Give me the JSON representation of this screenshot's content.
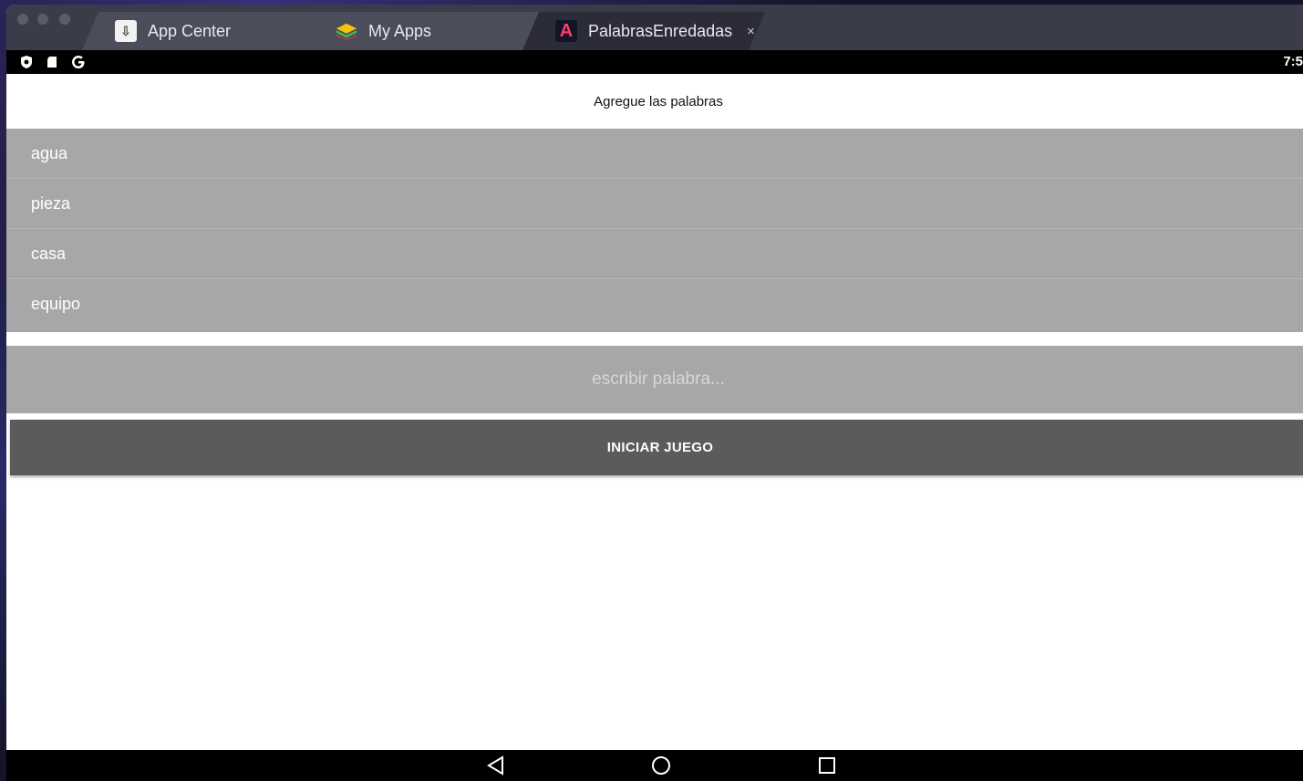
{
  "tabs": [
    {
      "label": "App Center",
      "icon": "app-center-icon"
    },
    {
      "label": "My Apps",
      "icon": "my-apps-icon"
    },
    {
      "label": "PalabrasEnredadas",
      "icon": "palabras-app-icon",
      "active": true,
      "close": "×"
    }
  ],
  "status_bar": {
    "clock": "7:5",
    "icons": [
      "shield-icon",
      "sd-card-icon",
      "google-g-icon"
    ]
  },
  "app": {
    "header_title": "Agregue las palabras",
    "words": [
      "agua",
      "pieza",
      "casa",
      "equipo"
    ],
    "input_placeholder": "escribir palabra...",
    "start_button": "INICIAR JUEGO"
  },
  "nav_bar": {
    "buttons": [
      "back-icon",
      "home-icon",
      "recents-icon"
    ]
  },
  "colors": {
    "list_bg": "#a7a7a7",
    "button_bg": "#5b5b5b",
    "tab_bar": "#3b3c4a"
  }
}
